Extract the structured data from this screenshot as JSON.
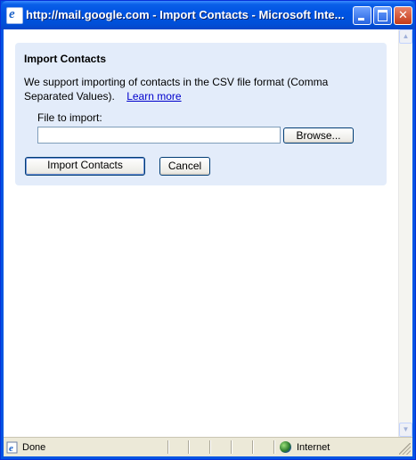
{
  "window": {
    "title": "http://mail.google.com - Import Contacts - Microsoft Inte...",
    "minimize_icon": "minimize-icon",
    "maximize_icon": "maximize-icon",
    "close_icon": "close-icon"
  },
  "panel": {
    "heading": "Import Contacts",
    "description": "We support importing of contacts in the CSV file format (Comma Separated Values).",
    "learn_more": "Learn more",
    "file_label": "File to import:",
    "file_value": "",
    "browse_button": "Browse...",
    "import_button": "Import Contacts",
    "cancel_button": "Cancel"
  },
  "statusbar": {
    "status": "Done",
    "zone": "Internet"
  },
  "colors": {
    "titlebar": "#0054e3",
    "panel_bg": "#e3ecfa",
    "link": "#0000cc"
  }
}
